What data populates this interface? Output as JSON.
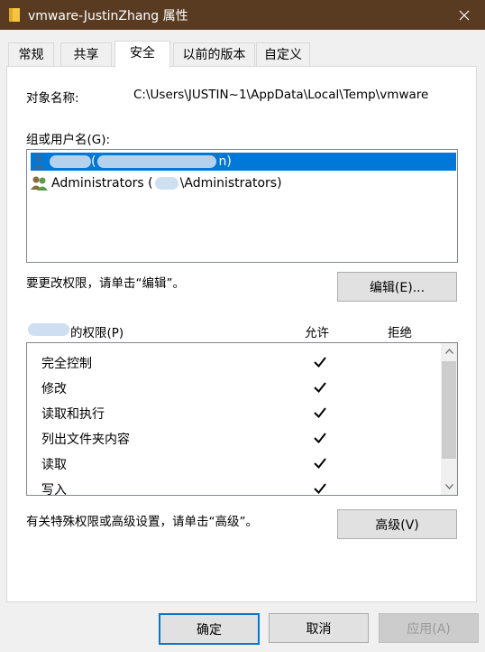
{
  "window": {
    "title": "vmware-JustinZhang 属性",
    "close_icon": "close-icon"
  },
  "tabs": [
    {
      "label": "常规"
    },
    {
      "label": "共享"
    },
    {
      "label": "安全"
    },
    {
      "label": "以前的版本"
    },
    {
      "label": "自定义"
    }
  ],
  "security": {
    "object_label": "对象名称:",
    "object_path": "C:\\Users\\JUSTIN~1\\AppData\\Local\\Temp\\vmware",
    "groups_label": "组或用户名(G):",
    "users": [
      {
        "name": "(",
        "suffix": "n)",
        "icon": "user-icon",
        "selected": true
      },
      {
        "name": "Administrators (",
        "suffix": "\\Administrators)",
        "icon": "users-group-icon",
        "selected": false
      }
    ],
    "change_hint": "要更改权限，请单击“编辑”。",
    "edit_button": "编辑(E)...",
    "perm_label": "的权限(P)",
    "allow_header": "允许",
    "deny_header": "拒绝",
    "permissions": [
      {
        "name": "完全控制",
        "allow": true,
        "deny": false
      },
      {
        "name": "修改",
        "allow": true,
        "deny": false
      },
      {
        "name": "读取和执行",
        "allow": true,
        "deny": false
      },
      {
        "name": "列出文件夹内容",
        "allow": true,
        "deny": false
      },
      {
        "name": "读取",
        "allow": true,
        "deny": false
      },
      {
        "name": "写入",
        "allow": true,
        "deny": false
      }
    ],
    "advanced_hint": "有关特殊权限或高级设置，请单击“高级”。",
    "advanced_button": "高级(V)"
  },
  "footer": {
    "ok": "确定",
    "cancel": "取消",
    "apply": "应用(A)"
  },
  "colors": {
    "titlebar": "#593b22",
    "selection": "#0078d7"
  }
}
